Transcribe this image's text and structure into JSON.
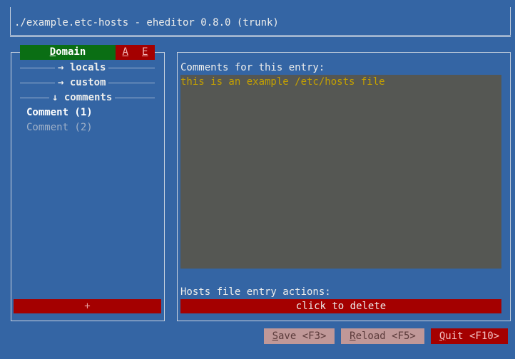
{
  "window": {
    "title": "./example.etc-hosts - eheditor 0.8.0 (trunk)"
  },
  "sidebar": {
    "tabs": {
      "domain_prefix": "D",
      "domain_rest": "omain",
      "a": "A",
      "e": "E"
    },
    "tree": [
      {
        "label": "→ locals"
      },
      {
        "label": "→ custom"
      },
      {
        "label": "↓ comments"
      }
    ],
    "comments": [
      {
        "label": "Comment (1)",
        "active": true
      },
      {
        "label": "Comment (2)",
        "active": false
      }
    ],
    "add_label": "+"
  },
  "main": {
    "comments_label": "Comments for this entry:",
    "comment_value": "this is an example /etc/hosts file",
    "actions_label": "Hosts file entry actions:",
    "delete_label": "click to delete"
  },
  "footer": {
    "save": {
      "key": "S",
      "rest": "ave <F3>"
    },
    "reload": {
      "key": "R",
      "rest": "eload <F5>"
    },
    "quit": {
      "key": "Q",
      "rest": "uit <F10>"
    }
  },
  "colors": {
    "background": "#3465a4",
    "domain_tab": "#0a6e14",
    "danger": "#a40000",
    "textarea_bg": "#555753",
    "textarea_fg": "#c4a000"
  }
}
